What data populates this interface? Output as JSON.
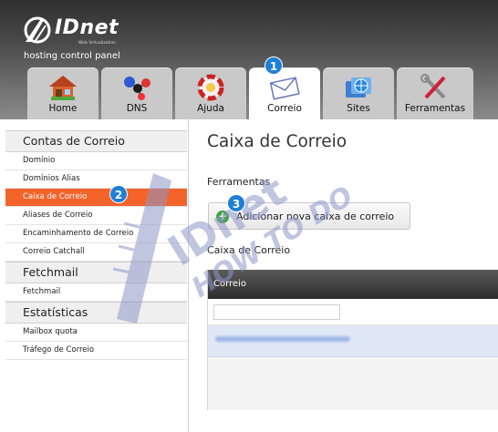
{
  "header": {
    "logo_text": "IDnet",
    "logo_tagline": "Web Virtualization",
    "subtitle": "hosting control panel"
  },
  "tabs": [
    {
      "label": "Home",
      "icon": "house-icon",
      "active": false
    },
    {
      "label": "DNS",
      "icon": "network-molecule-icon",
      "active": false
    },
    {
      "label": "Ajuda",
      "icon": "lifebuoy-icon",
      "active": false
    },
    {
      "label": "Correio",
      "icon": "envelope-icon",
      "active": true
    },
    {
      "label": "Sites",
      "icon": "globe-folder-icon",
      "active": false
    },
    {
      "label": "Ferramentas",
      "icon": "tools-icon",
      "active": false
    }
  ],
  "badges": [
    "1",
    "2",
    "3"
  ],
  "sidebar": {
    "sections": [
      {
        "title": "Contas de Correio",
        "items": [
          "Domínio",
          "Domínios Alias",
          "Caixa de Correio",
          "Aliases de Correio",
          "Encaminhamento de Correio",
          "Correio Catchall"
        ]
      },
      {
        "title": "Fetchmail",
        "items": [
          "Fetchmail"
        ]
      },
      {
        "title": "Estatísticas",
        "items": [
          "Mailbox quota",
          "Tráfego de Correio"
        ]
      }
    ],
    "active_item": "Caixa de Correio"
  },
  "main": {
    "title": "Caixa de Correio",
    "tools_label": "Ferramentas",
    "add_button": "Adicionar nova caixa de correio",
    "section_label": "Caixa de Correio",
    "table": {
      "column": "Correio",
      "filter_value": ""
    }
  },
  "watermark": {
    "line1": "IDnet",
    "line2": "HOW TO DO"
  },
  "colors": {
    "accent": "#f3632a",
    "badge": "#1f7fd6",
    "table_header": "#3a3a3a"
  }
}
